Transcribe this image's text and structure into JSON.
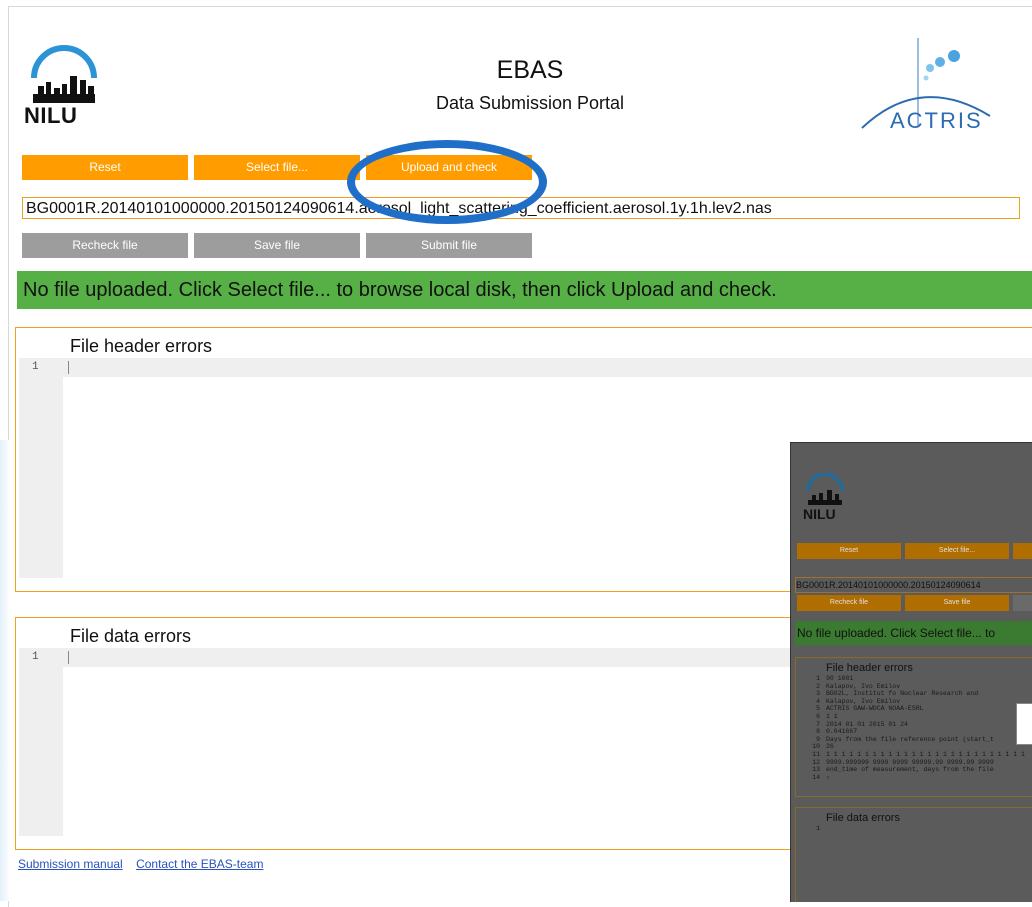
{
  "header": {
    "nilu_logo_text": "NILU",
    "title": "EBAS",
    "subtitle": "Data Submission Portal",
    "actris_logo_text": "ACTRIS"
  },
  "toolbar1": {
    "reset": "Reset",
    "select_file": "Select file...",
    "upload_check": "Upload and check"
  },
  "file_input": {
    "value": "BG0001R.20140101000000.20150124090614.aerosol_light_scattering_coefficient.aerosol.1y.1h.lev2.nas"
  },
  "toolbar2": {
    "recheck": "Recheck file",
    "save": "Save file",
    "submit": "Submit file"
  },
  "status": {
    "message": "No file uploaded. Click Select file... to browse local disk, then click Upload and check."
  },
  "header_errors": {
    "title": "File header errors",
    "line_no": "1"
  },
  "data_errors": {
    "title": "File data errors",
    "line_no": "1"
  },
  "footer": {
    "manual": "Submission manual",
    "contact": "Contact the EBAS-team"
  },
  "inset": {
    "nilu": "NILU",
    "reset": "Reset",
    "select_file": "Select file...",
    "recheck": "Recheck file",
    "save": "Save file",
    "file_value": "BG0001R.20140101000000.20150124090614",
    "status": "No file uploaded. Click Select file... to",
    "header_title": "File header errors",
    "header_lines": [
      {
        "n": "1",
        "t": "90 1001"
      },
      {
        "n": "2",
        "t": "Kalapov, Ivo Emilov"
      },
      {
        "n": "3",
        "t": "BG02L, Institut fo Nuclear Research and"
      },
      {
        "n": "4",
        "t": "Kalapov, Ivo Emilov"
      },
      {
        "n": "5",
        "t": "ACTRIS GAW-WDCA NOAA-ESRL"
      },
      {
        "n": "6",
        "t": "1 1"
      },
      {
        "n": "7",
        "t": "2014 01 01 2015 01 24"
      },
      {
        "n": "8",
        "t": "0.041667"
      },
      {
        "n": "9",
        "t": "Days from the file reference point (start_t"
      },
      {
        "n": "10",
        "t": "26"
      },
      {
        "n": "11",
        "t": "1 1 1 1 1 1 1 1 1 1 1 1 1 1 1 1 1 1 1 1 1 1 1 1 1 1"
      },
      {
        "n": "12",
        "t": "9999.999999 9999 9999 99999.99 9999.99 9999"
      },
      {
        "n": "13",
        "t": "end_time of measurement, days from the file"
      },
      {
        "n": "14",
        "t": "‹"
      }
    ],
    "data_title": "File data errors",
    "data_line_no": "1"
  },
  "colors": {
    "orange_button": "#ff9d00",
    "gray_button": "#9d9d9d",
    "status_green": "#56b046",
    "highlight_blue": "#1f6fc8",
    "link": "#2a52be"
  }
}
